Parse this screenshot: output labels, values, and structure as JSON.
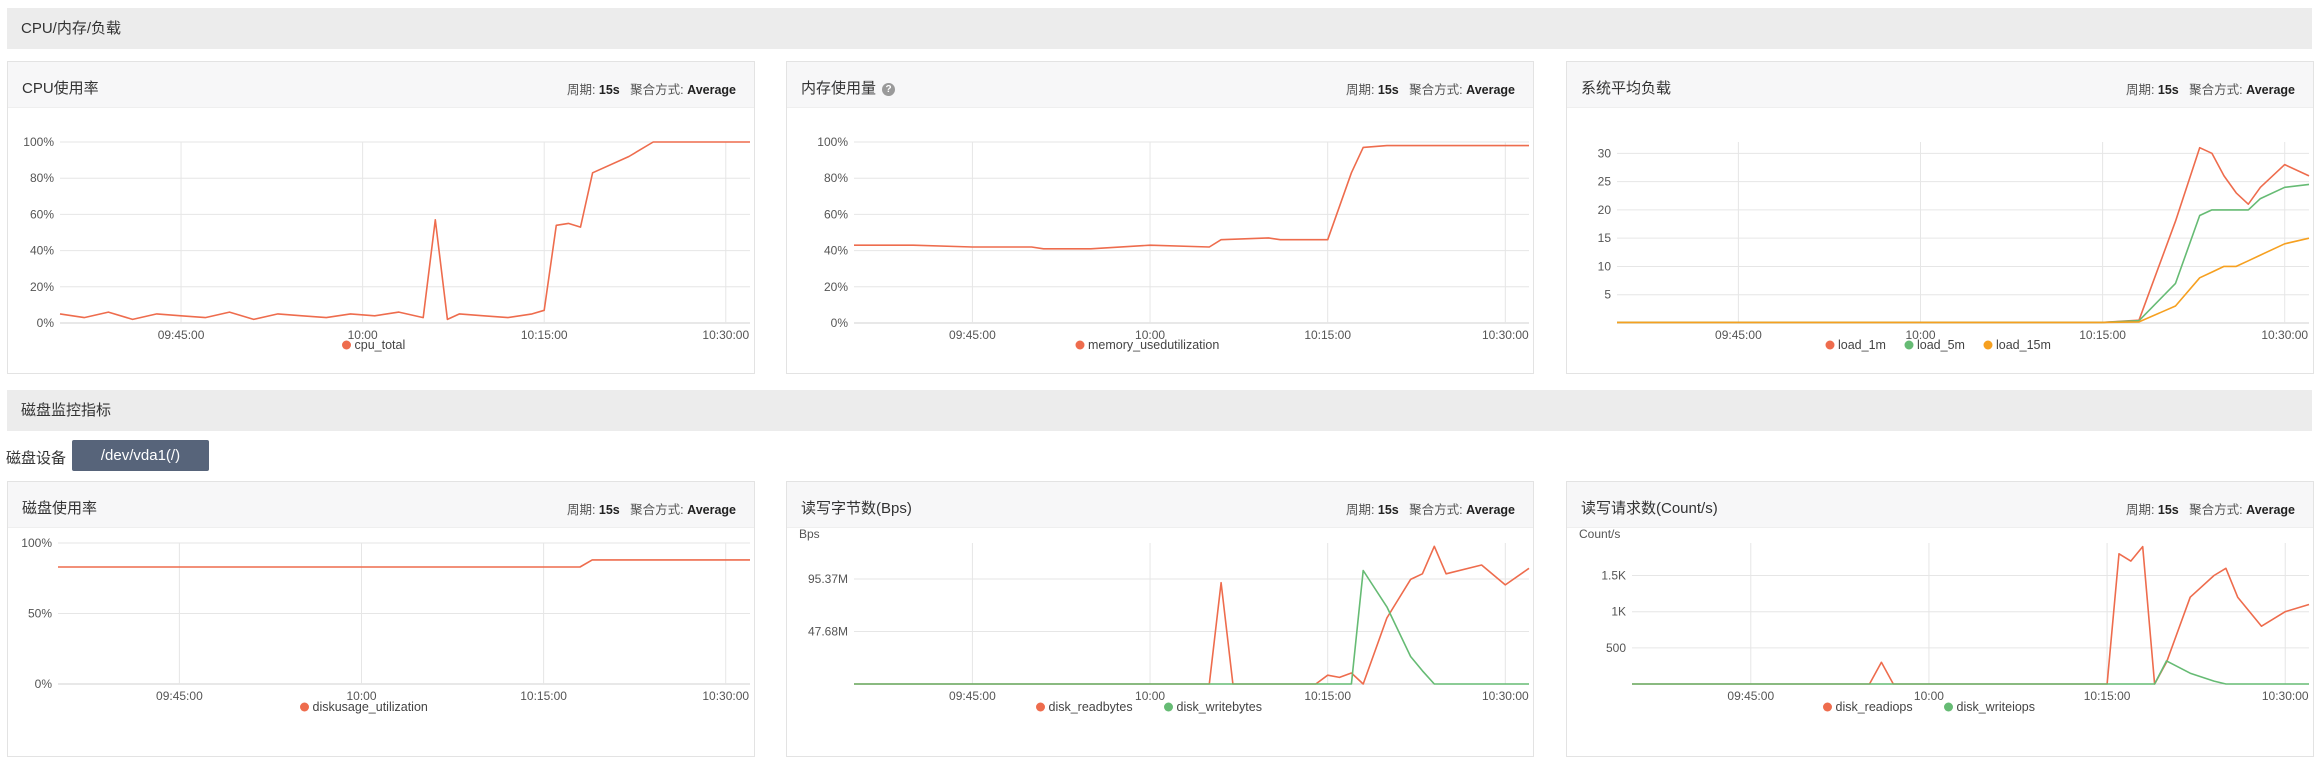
{
  "sections": {
    "cpu_mem_load": "CPU/内存/负载",
    "disk": "磁盘监控指标"
  },
  "disk_device": {
    "label": "磁盘设备",
    "value": "/dev/vda1(/)"
  },
  "meta": {
    "period_label": "周期:",
    "period_value": "15s",
    "agg_label": "聚合方式:",
    "agg_value": "Average"
  },
  "colors": {
    "series_red": "#ee6c4d",
    "series_green": "#66bb74",
    "series_orange": "#f6a020",
    "grid": "#e6e6e6"
  },
  "icons": {
    "help": "question-circle-icon"
  },
  "help_glyph": "?",
  "panels": [
    {
      "title": "CPU使用率",
      "help": false
    },
    {
      "title": "内存使用量",
      "help": true
    },
    {
      "title": "系统平均负载",
      "help": false
    },
    {
      "title": "磁盘使用率",
      "help": false
    },
    {
      "title": "读写字节数(Bps)",
      "help": false
    },
    {
      "title": "读写请求数(Count/s)",
      "help": false
    }
  ],
  "chart_data": [
    {
      "type": "line",
      "x_ticks": [
        "09:45:00",
        "10:00",
        "10:15:00",
        "10:30:00"
      ],
      "x": [
        "09:35",
        "09:37",
        "09:39",
        "09:41",
        "09:43",
        "09:45",
        "09:47",
        "09:49",
        "09:51",
        "09:53",
        "09:55",
        "09:57",
        "09:59",
        "10:01",
        "10:03",
        "10:05",
        "10:06",
        "10:07",
        "10:08",
        "10:10",
        "10:12",
        "10:14",
        "10:15",
        "10:16",
        "10:17",
        "10:18",
        "10:19",
        "10:22",
        "10:24",
        "10:26",
        "10:28",
        "10:30",
        "10:32"
      ],
      "y_ticks": [
        "100%",
        "80%",
        "60%",
        "40%",
        "20%",
        "0%"
      ],
      "ylim": [
        0,
        100
      ],
      "series": [
        {
          "name": "cpu_total",
          "color": "#ee6c4d",
          "values": [
            5,
            3,
            6,
            2,
            5,
            4,
            3,
            6,
            2,
            5,
            4,
            3,
            5,
            4,
            6,
            3,
            57,
            2,
            5,
            4,
            3,
            5,
            7,
            54,
            55,
            53,
            83,
            92,
            100,
            100,
            100,
            100,
            100
          ]
        }
      ]
    },
    {
      "type": "line",
      "x_ticks": [
        "09:45:00",
        "10:00",
        "10:15:00",
        "10:30:00"
      ],
      "x": [
        "09:35",
        "09:40",
        "09:45",
        "09:50",
        "09:51",
        "09:55",
        "10:00",
        "10:05",
        "10:06",
        "10:10",
        "10:11",
        "10:15",
        "10:17",
        "10:18",
        "10:20",
        "10:25",
        "10:30",
        "10:32"
      ],
      "y_ticks": [
        "100%",
        "80%",
        "60%",
        "40%",
        "20%",
        "0%"
      ],
      "ylim": [
        0,
        100
      ],
      "series": [
        {
          "name": "memory_usedutilization",
          "color": "#ee6c4d",
          "values": [
            43,
            43,
            42,
            42,
            41,
            41,
            43,
            42,
            46,
            47,
            46,
            46,
            83,
            97,
            98,
            98,
            98,
            98
          ]
        }
      ]
    },
    {
      "type": "line",
      "x_ticks": [
        "09:45:00",
        "10:00",
        "10:15:00",
        "10:30:00"
      ],
      "x": [
        "09:35",
        "09:45",
        "10:00",
        "10:10",
        "10:15",
        "10:18",
        "10:21",
        "10:23",
        "10:24",
        "10:25",
        "10:26",
        "10:27",
        "10:28",
        "10:30",
        "10:32"
      ],
      "y_ticks": [
        "30",
        "25",
        "20",
        "15",
        "10",
        "5"
      ],
      "ylim": [
        0,
        32
      ],
      "series": [
        {
          "name": "load_1m",
          "color": "#ee6c4d",
          "values": [
            0.1,
            0.1,
            0.1,
            0.1,
            0.1,
            0.5,
            18,
            31,
            30,
            26,
            23,
            21,
            24,
            28,
            26
          ]
        },
        {
          "name": "load_5m",
          "color": "#66bb74",
          "values": [
            0.1,
            0.1,
            0.1,
            0.1,
            0.1,
            0.4,
            7,
            19,
            20,
            20,
            20,
            20,
            22,
            24,
            24.5
          ]
        },
        {
          "name": "load_15m",
          "color": "#f6a020",
          "values": [
            0.1,
            0.1,
            0.1,
            0.1,
            0.1,
            0.2,
            3,
            8,
            9,
            10,
            10,
            11,
            12,
            14,
            15
          ]
        }
      ]
    },
    {
      "type": "line",
      "x_ticks": [
        "09:45:00",
        "10:00",
        "10:15:00",
        "10:30:00"
      ],
      "x": [
        "09:35",
        "09:45",
        "10:00",
        "10:15",
        "10:18",
        "10:19",
        "10:25",
        "10:32"
      ],
      "y_ticks": [
        "100%",
        "50%",
        "0%"
      ],
      "ylim": [
        0,
        100
      ],
      "series": [
        {
          "name": "diskusage_utilization",
          "color": "#ee6c4d",
          "values": [
            83,
            83,
            83,
            83,
            83,
            88,
            88,
            88
          ]
        }
      ]
    },
    {
      "type": "line",
      "ylabel": "Bps",
      "x_ticks": [
        "09:45:00",
        "10:00",
        "10:15:00",
        "10:30:00"
      ],
      "x": [
        "09:35",
        "10:00",
        "10:05",
        "10:06",
        "10:07",
        "10:14",
        "10:15",
        "10:16",
        "10:17",
        "10:18",
        "10:20",
        "10:22",
        "10:23",
        "10:24",
        "10:25",
        "10:28",
        "10:30",
        "10:32"
      ],
      "y_ticks": [
        "95.37M",
        "47.68M"
      ],
      "ylim": [
        0,
        128
      ],
      "series": [
        {
          "name": "disk_readbytes",
          "color": "#ee6c4d",
          "values": [
            0,
            0,
            0,
            92,
            0,
            0,
            8,
            6,
            10,
            0,
            60,
            95,
            100,
            125,
            100,
            108,
            90,
            105
          ]
        },
        {
          "name": "disk_writebytes",
          "color": "#66bb74",
          "values": [
            0,
            0,
            0,
            0,
            0,
            0,
            0,
            0,
            0,
            103,
            70,
            25,
            12,
            0,
            0,
            0,
            0,
            0
          ]
        }
      ]
    },
    {
      "type": "line",
      "ylabel": "Count/s",
      "x_ticks": [
        "09:45:00",
        "10:00",
        "10:15:00",
        "10:30:00"
      ],
      "x": [
        "09:35",
        "09:40",
        "09:55",
        "09:56",
        "09:57",
        "10:14",
        "10:15",
        "10:16",
        "10:17",
        "10:18",
        "10:19",
        "10:20",
        "10:22",
        "10:24",
        "10:25",
        "10:26",
        "10:28",
        "10:30",
        "10:32"
      ],
      "y_ticks": [
        "1.5K",
        "1K",
        "500"
      ],
      "ylim": [
        0,
        1950
      ],
      "series": [
        {
          "name": "disk_readiops",
          "color": "#ee6c4d",
          "values": [
            0,
            0,
            0,
            300,
            0,
            0,
            0,
            1800,
            1700,
            1900,
            0,
            300,
            1200,
            1500,
            1600,
            1200,
            800,
            1000,
            1100
          ]
        },
        {
          "name": "disk_writeiops",
          "color": "#66bb74",
          "values": [
            0,
            0,
            0,
            0,
            0,
            0,
            0,
            0,
            0,
            0,
            0,
            320,
            150,
            40,
            0,
            0,
            0,
            0,
            0
          ]
        }
      ]
    }
  ]
}
